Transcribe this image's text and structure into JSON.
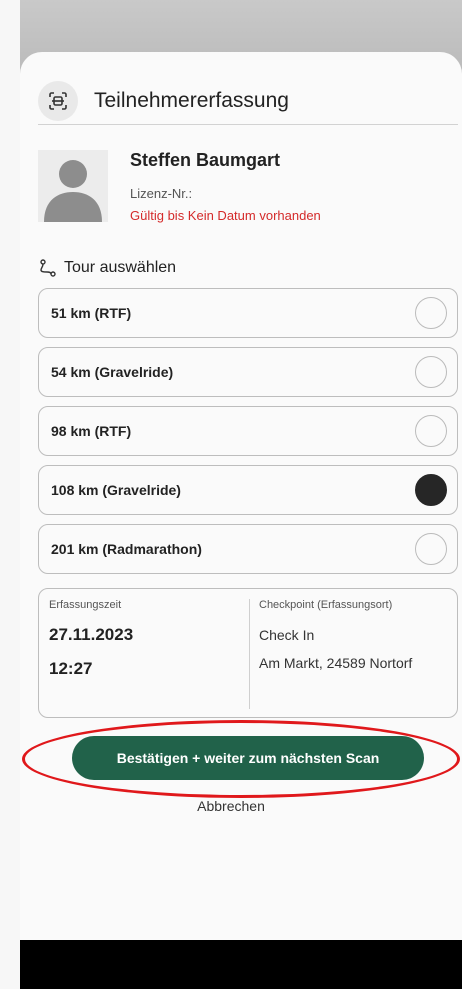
{
  "header": {
    "title": "Teilnehmererfassung",
    "icon": "scan-icon"
  },
  "participant": {
    "name": "Steffen Baumgart",
    "license_label": "Lizenz-Nr.:",
    "validity_text": "Gültig bis Kein Datum vorhanden",
    "validity_color": "#d42a2a"
  },
  "tour": {
    "heading": "Tour auswählen",
    "icon": "route-icon",
    "options": [
      {
        "label": "51 km (RTF)",
        "selected": false
      },
      {
        "label": "54 km (Gravelride)",
        "selected": false
      },
      {
        "label": "98 km (RTF)",
        "selected": false
      },
      {
        "label": "108 km (Gravelride)",
        "selected": true
      },
      {
        "label": "201 km (Radmarathon)",
        "selected": false
      }
    ]
  },
  "info": {
    "time_label": "Erfassungszeit",
    "date": "27.11.2023",
    "time": "12:27",
    "checkpoint_label": "Checkpoint (Erfassungsort)",
    "checkpoint_name": "Check In",
    "checkpoint_address": "Am Markt, 24589 Nortorf"
  },
  "actions": {
    "confirm_label": "Bestätigen + weiter zum nächsten Scan",
    "cancel_label": "Abbrechen"
  },
  "colors": {
    "accent": "#21624a",
    "highlight": "#e0181b"
  }
}
